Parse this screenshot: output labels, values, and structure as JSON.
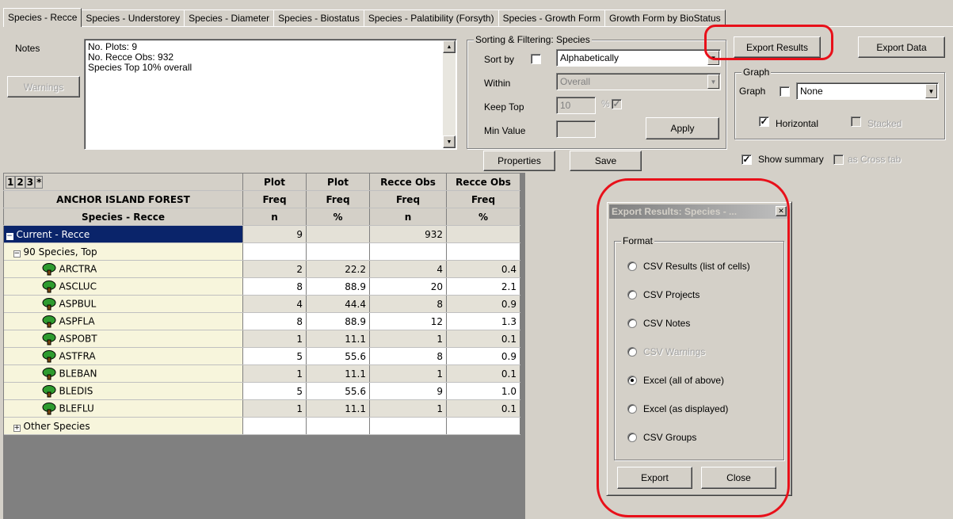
{
  "tabs": [
    "Species - Recce",
    "Species - Understorey",
    "Species - Diameter",
    "Species - Biostatus",
    "Species - Palatibility (Forsyth)",
    "Species - Growth Form",
    "Growth Form by BioStatus"
  ],
  "notes": {
    "label": "Notes",
    "warnings_button": "Warnings",
    "lines": [
      "No. Plots: 9",
      "No. Recce Obs: 932",
      "Species Top 10% overall"
    ]
  },
  "sorting": {
    "title": "Sorting & Filtering: Species",
    "sort_by_label": "Sort by",
    "sort_by_value": "Alphabetically",
    "within_label": "Within",
    "within_value": "Overall",
    "keep_top_label": "Keep Top",
    "keep_top_value": "10",
    "percent_label": "%",
    "min_value_label": "Min Value",
    "apply_button": "Apply"
  },
  "export_results_button": "Export Results",
  "export_data_button": "Export Data",
  "graph": {
    "title": "Graph",
    "graph_label": "Graph",
    "graph_value": "None",
    "horizontal_label": "Horizontal",
    "stacked_label": "Stacked"
  },
  "properties_button": "Properties",
  "save_button": "Save",
  "show_summary_label": "Show summary",
  "as_cross_tab_label": "as Cross tab",
  "grid": {
    "levels": [
      "1",
      "2",
      "3",
      "*"
    ],
    "header1": [
      "Plot",
      "Plot",
      "Recce Obs",
      "Recce Obs"
    ],
    "header2_label": "ANCHOR ISLAND FOREST",
    "header2": [
      "Freq",
      "Freq",
      "Freq",
      "Freq"
    ],
    "header3_label": "Species - Recce",
    "header3": [
      "n",
      "%",
      "n",
      "%"
    ],
    "current_label": "Current - Recce",
    "current_values": [
      "9",
      "",
      "932",
      ""
    ],
    "group_label": "90 Species, Top",
    "rows": [
      {
        "name": "ARCTRA",
        "v": [
          "2",
          "22.2",
          "4",
          "0.4"
        ]
      },
      {
        "name": "ASCLUC",
        "v": [
          "8",
          "88.9",
          "20",
          "2.1"
        ]
      },
      {
        "name": "ASPBUL",
        "v": [
          "4",
          "44.4",
          "8",
          "0.9"
        ]
      },
      {
        "name": "ASPFLA",
        "v": [
          "8",
          "88.9",
          "12",
          "1.3"
        ]
      },
      {
        "name": "ASPOBT",
        "v": [
          "1",
          "11.1",
          "1",
          "0.1"
        ]
      },
      {
        "name": "ASTFRA",
        "v": [
          "5",
          "55.6",
          "8",
          "0.9"
        ]
      },
      {
        "name": "BLEBAN",
        "v": [
          "1",
          "11.1",
          "1",
          "0.1"
        ]
      },
      {
        "name": "BLEDIS",
        "v": [
          "5",
          "55.6",
          "9",
          "1.0"
        ]
      },
      {
        "name": "BLEFLU",
        "v": [
          "1",
          "11.1",
          "1",
          "0.1"
        ]
      }
    ],
    "other_label": "Other Species"
  },
  "dialog": {
    "title": "Export Results: Species - ...",
    "format_label": "Format",
    "options": [
      {
        "label": "CSV Results (list of cells)",
        "selected": false,
        "disabled": false
      },
      {
        "label": "CSV Projects",
        "selected": false,
        "disabled": false
      },
      {
        "label": "CSV Notes",
        "selected": false,
        "disabled": false
      },
      {
        "label": "CSV Warnings",
        "selected": false,
        "disabled": true
      },
      {
        "label": "Excel (all of above)",
        "selected": true,
        "disabled": false
      },
      {
        "label": "Excel (as displayed)",
        "selected": false,
        "disabled": false
      },
      {
        "label": "CSV Groups",
        "selected": false,
        "disabled": false
      }
    ],
    "export_button": "Export",
    "close_button": "Close"
  },
  "colors": {
    "highlight": "#e8101a",
    "selection": "#0a246a"
  }
}
